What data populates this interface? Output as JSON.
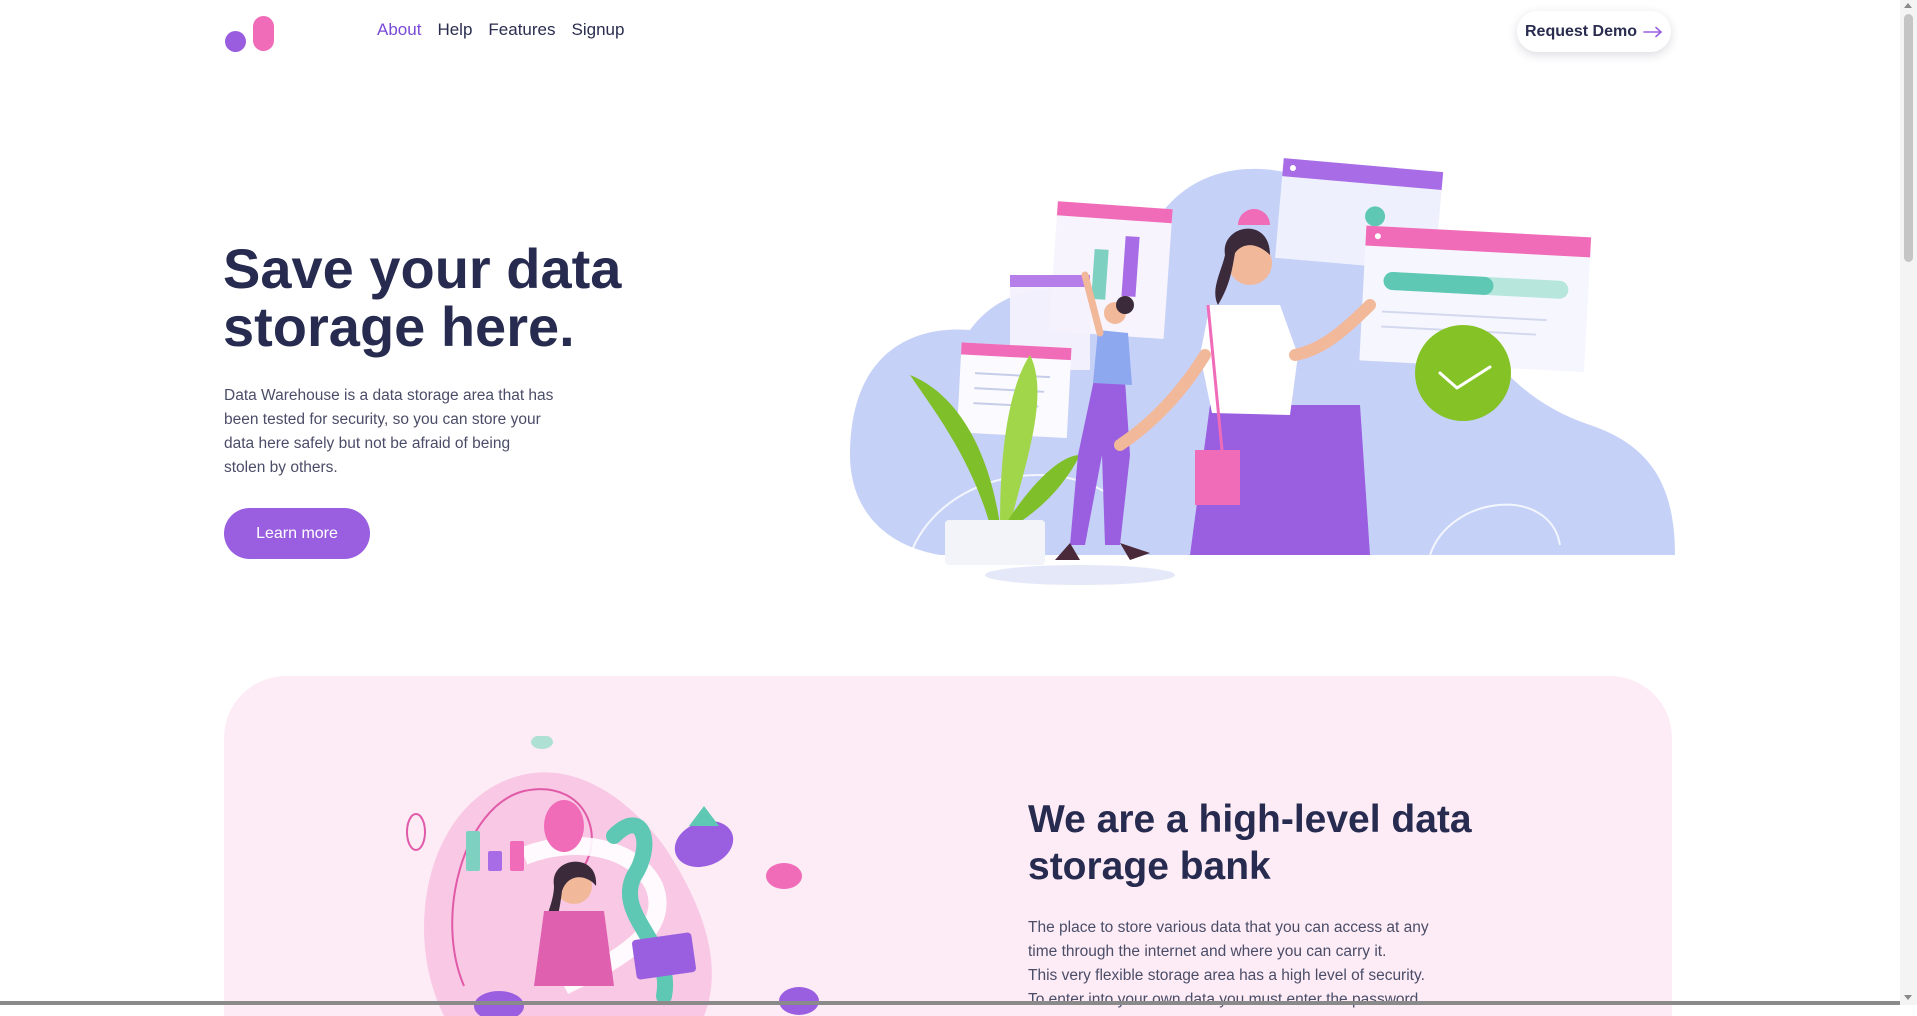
{
  "header": {
    "logo_icon": "brand-logo-icon",
    "nav": [
      {
        "label": "About",
        "active": true
      },
      {
        "label": "Help",
        "active": false
      },
      {
        "label": "Features",
        "active": false
      },
      {
        "label": "Signup",
        "active": false
      }
    ],
    "demo_button": "Request Demo",
    "demo_icon": "arrow-right-icon"
  },
  "hero": {
    "title": "Save your data storage here.",
    "description": "Data Warehouse is a data storage area that has been tested for security, so you can store your data here safely but not be afraid of being stolen by others.",
    "button": "Learn more",
    "illustration_icon": "data-storage-illustration"
  },
  "section2": {
    "title": "We are a high-level data storage bank",
    "description_lines": [
      "The place to store various data that you can access at any",
      "time through the internet and where you can carry it.",
      "This very flexible storage area has a high level of security.",
      "To enter into your own data you must enter the password"
    ],
    "illustration_icon": "data-analytics-illustration"
  },
  "colors": {
    "accent": "#9a5fe0",
    "pink": "#f06bb8",
    "text_dark": "#262b4f",
    "section_bg": "#fdecf6",
    "green": "#85c226"
  }
}
